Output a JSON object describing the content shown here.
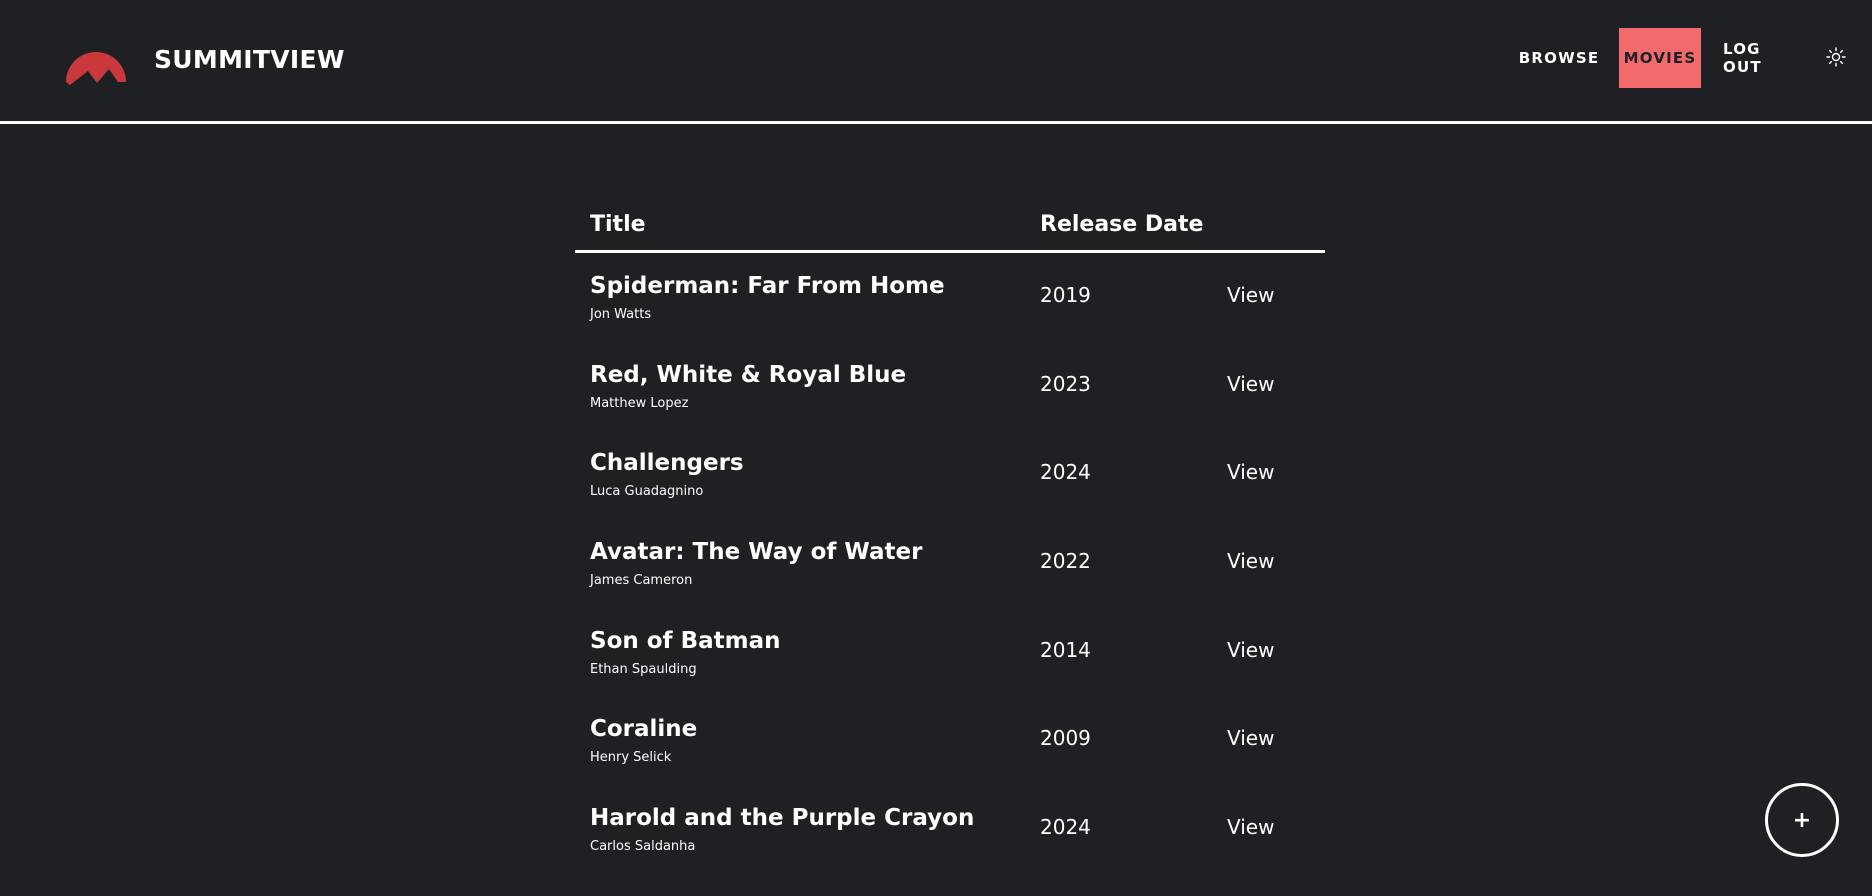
{
  "header": {
    "app_name": "SUMMITVIEW",
    "logo_icon": "mountain-logo-icon",
    "nav": {
      "browse": "BROWSE",
      "movies": "MOVIES",
      "log_out": "LOG OUT",
      "theme_icon": "sun-icon",
      "active_color": "#f26a6c"
    }
  },
  "table": {
    "headers": {
      "title": "Title",
      "release_date": "Release Date"
    },
    "rows": [
      {
        "title": "Spiderman: Far From Home",
        "director": "Jon Watts",
        "year": "2019",
        "action": "View"
      },
      {
        "title": "Red, White & Royal Blue",
        "director": "Matthew Lopez",
        "year": "2023",
        "action": "View"
      },
      {
        "title": "Challengers",
        "director": "Luca Guadagnino",
        "year": "2024",
        "action": "View"
      },
      {
        "title": "Avatar: The Way of Water",
        "director": "James Cameron",
        "year": "2022",
        "action": "View"
      },
      {
        "title": "Son of Batman",
        "director": "Ethan Spaulding",
        "year": "2014",
        "action": "View"
      },
      {
        "title": "Coraline",
        "director": "Henry Selick",
        "year": "2009",
        "action": "View"
      },
      {
        "title": "Harold and the Purple Crayon",
        "director": "Carlos Saldanha",
        "year": "2024",
        "action": "View"
      }
    ]
  },
  "fab": {
    "label": "+",
    "icon": "plus-icon"
  },
  "colors": {
    "background": "#1e2024",
    "accent": "#f26a6c",
    "logo": "#c9383a"
  }
}
